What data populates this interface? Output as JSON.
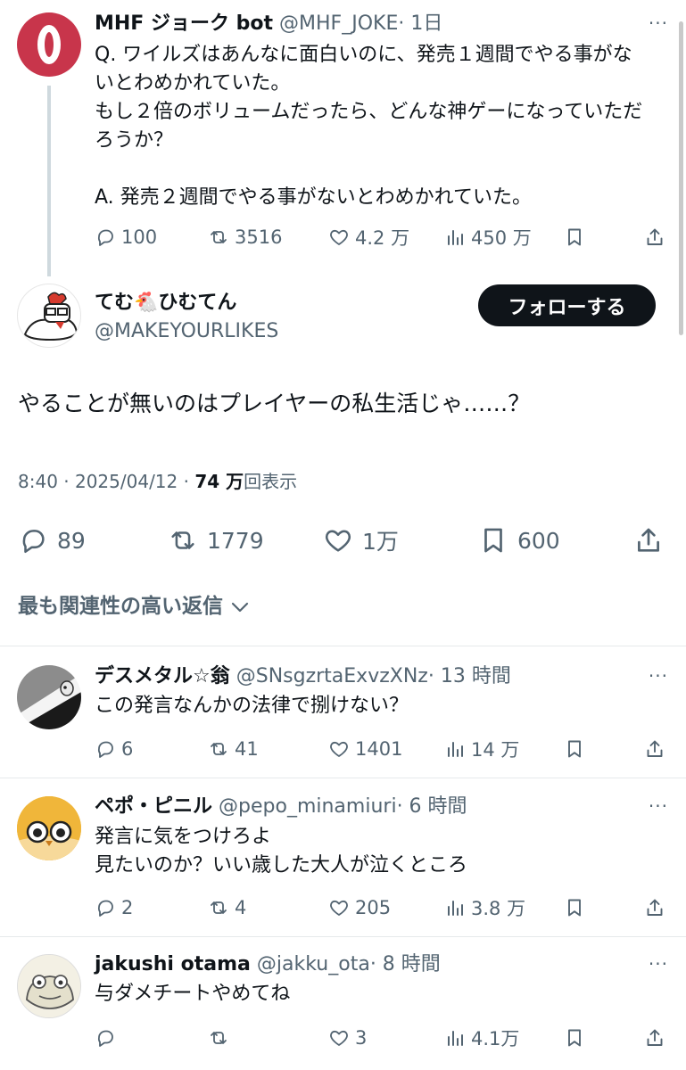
{
  "quoted_tweet": {
    "name": "MHF ジョーク bot",
    "handle": "@MHF_JOKE",
    "time": "· 1日",
    "more": "···",
    "lines": [
      "Q. ワイルズはあんなに面白いのに、発売１週間でやる事がな",
      "いとわめかれていた。",
      "もし２倍のボリュームだったら、どんな神ゲーになっていただ",
      "ろうか？",
      "",
      "A. 発売２週間でやる事がないとわめかれていた。"
    ],
    "replies": "100",
    "retweets": "3516",
    "likes": "4.2 万",
    "views": "450 万"
  },
  "main_tweet": {
    "name": "てむ🐔ひむてん",
    "handle": "@MAKEYOURLIKES",
    "follow_label": "フォローする",
    "text": "やることが無いのはプレイヤーの私生活じゃ……？",
    "time": "8:40 · 2025/04/12 · ",
    "views_count": "74 万",
    "views_label": "回表示",
    "replies": "89",
    "retweets": "1779",
    "likes": "1万",
    "bookmarks": "600"
  },
  "sort_label": "最も関連性の高い返信",
  "replies": [
    {
      "name": "デスメタル☆翁",
      "handle": "@SNsgzrtaExvzXNz",
      "time": "· 13 時間",
      "lines": [
        "この発言なんかの法律で捌けない？"
      ],
      "replies": "6",
      "retweets": "41",
      "likes": "1401",
      "views": "14 万"
    },
    {
      "name": "ペポ・ピニル",
      "handle": "@pepo_minamiuri",
      "time": "· 6 時間",
      "lines": [
        "発言に気をつけろよ",
        "見たいのか？いい歳した大人が泣くところ"
      ],
      "replies": "2",
      "retweets": "4",
      "likes": "205",
      "views": "3.8 万"
    },
    {
      "name": "jakushi otama",
      "handle": "@jakku_ota",
      "time": "· 8 時間",
      "lines": [
        "与ダメチートやめてね"
      ],
      "replies": "",
      "retweets": "",
      "likes": "3",
      "views": "4.1万"
    }
  ]
}
